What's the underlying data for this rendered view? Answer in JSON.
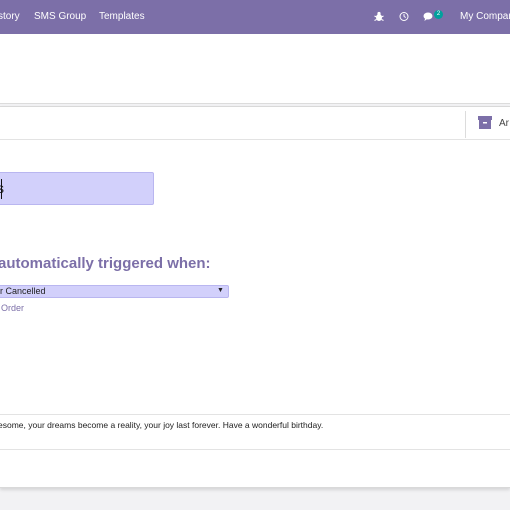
{
  "topbar": {
    "menu": [
      "story",
      "SMS Group",
      "Templates"
    ],
    "chat_count": "2",
    "company": "My Compan"
  },
  "buttons": {
    "archive_label": "Ar"
  },
  "form": {
    "name_value": "s",
    "trigger_heading": "automatically triggered when:",
    "trigger_value": "r Cancelled",
    "model_link": "Order",
    "message": "esome, your dreams become a reality, your joy last forever. Have a wonderful birthday."
  },
  "colors": {
    "accent": "#7c6fa8",
    "input_bg": "#d2d0fb",
    "badge": "#00a09d"
  },
  "icons": [
    "bug-icon",
    "clock-icon",
    "chat-icon",
    "archive-icon",
    "caret-down-icon"
  ]
}
